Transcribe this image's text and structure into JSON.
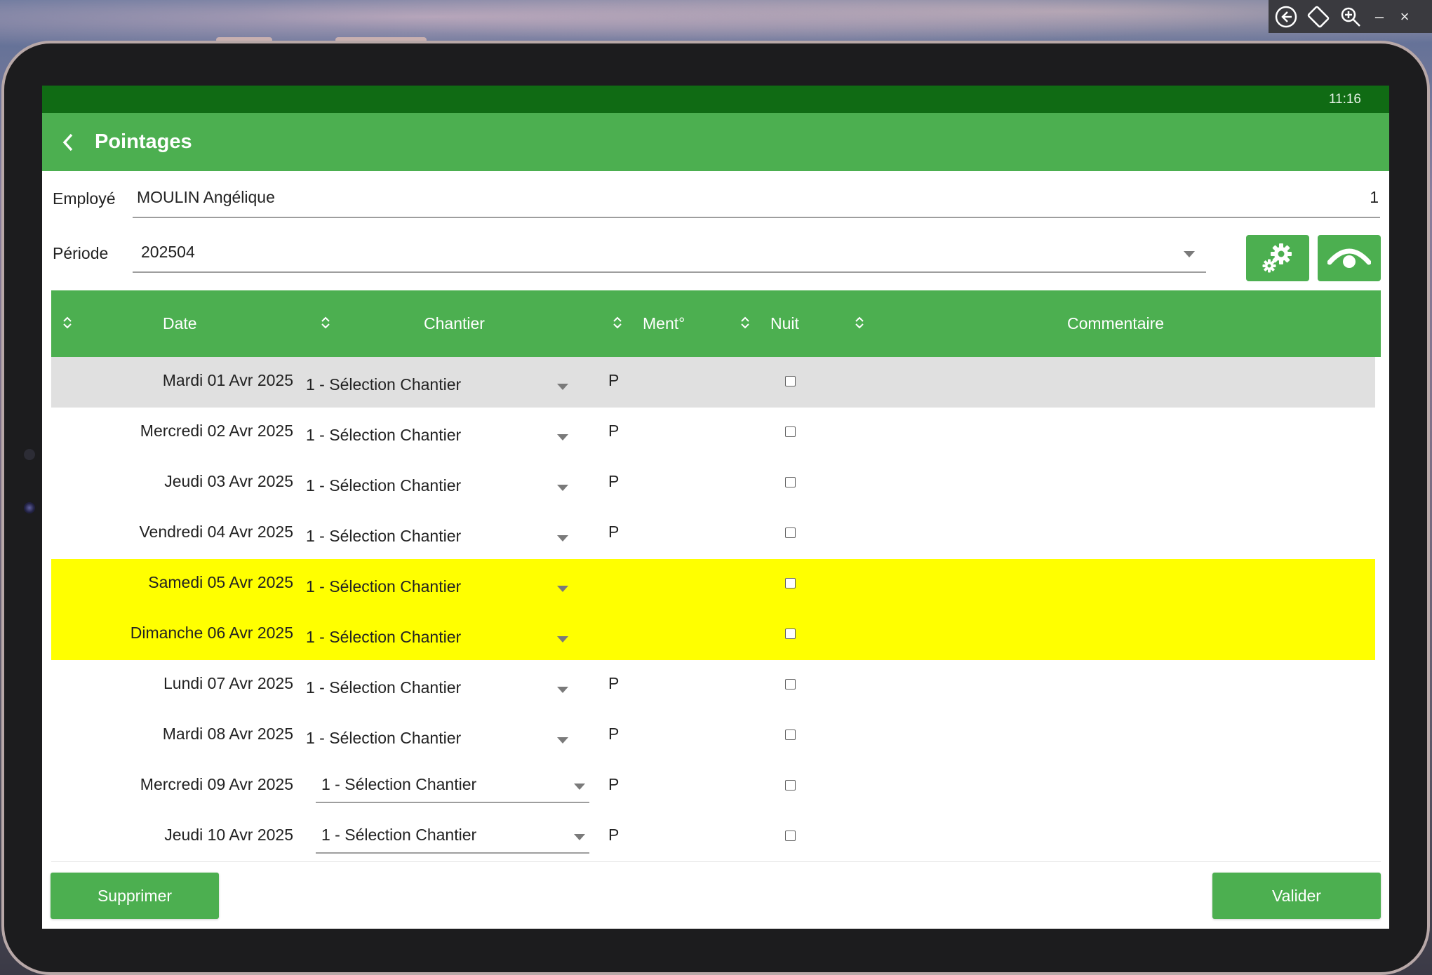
{
  "statusbar": {
    "time": "11:16"
  },
  "appbar": {
    "title": "Pointages"
  },
  "form": {
    "employe_label": "Employé",
    "employe_value": "MOULIN Angélique",
    "employe_number": "1",
    "periode_label": "Période",
    "periode_value": "202504"
  },
  "table": {
    "headers": {
      "date": "Date",
      "chantier": "Chantier",
      "ment": "Ment°",
      "nuit": "Nuit",
      "commentaire": "Commentaire"
    },
    "rows": [
      {
        "date": "Mardi 01 Avr 2025",
        "chantier": "1 - Sélection Chantier",
        "ment": "P",
        "nuit": false,
        "style": "grey"
      },
      {
        "date": "Mercredi 02 Avr 2025",
        "chantier": "1 - Sélection Chantier",
        "ment": "P",
        "nuit": false,
        "style": "white"
      },
      {
        "date": "Jeudi 03 Avr 2025",
        "chantier": "1 - Sélection Chantier",
        "ment": "P",
        "nuit": false,
        "style": "white"
      },
      {
        "date": "Vendredi 04 Avr 2025",
        "chantier": "1 - Sélection Chantier",
        "ment": "P",
        "nuit": false,
        "style": "white"
      },
      {
        "date": "Samedi 05 Avr 2025",
        "chantier": "1 - Sélection Chantier",
        "ment": "",
        "nuit": false,
        "style": "yellow"
      },
      {
        "date": "Dimanche 06 Avr 2025",
        "chantier": "1 - Sélection Chantier",
        "ment": "",
        "nuit": false,
        "style": "yellow"
      },
      {
        "date": "Lundi 07 Avr 2025",
        "chantier": "1 - Sélection Chantier",
        "ment": "P",
        "nuit": false,
        "style": "white"
      },
      {
        "date": "Mardi 08 Avr 2025",
        "chantier": "1 - Sélection Chantier",
        "ment": "P",
        "nuit": false,
        "style": "white"
      },
      {
        "date": "Mercredi 09 Avr 2025",
        "chantier": "1 - Sélection Chantier",
        "ment": "P",
        "nuit": false,
        "style": "white-underlined"
      },
      {
        "date": "Jeudi 10 Avr 2025",
        "chantier": "1 - Sélection Chantier",
        "ment": "P",
        "nuit": false,
        "style": "white-underlined"
      }
    ]
  },
  "buttons": {
    "supprimer": "Supprimer",
    "valider": "Valider"
  },
  "icons": {
    "back": "back-arrow-icon",
    "settings": "gears-icon",
    "view": "eye-icon"
  },
  "colors": {
    "status_bar": "#106b14",
    "primary": "#4caf50",
    "weekend_row": "#ffff00",
    "selected_row": "#e0e0e0"
  }
}
